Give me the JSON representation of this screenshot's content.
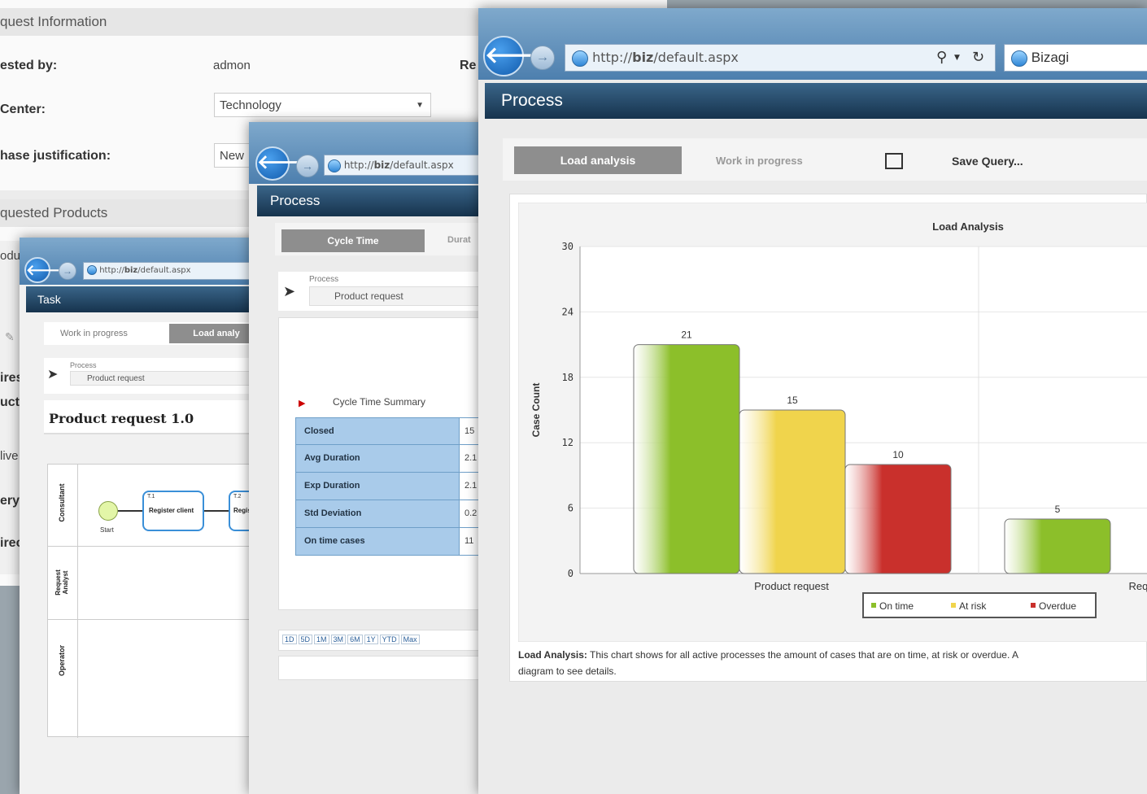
{
  "form": {
    "request_info_header": "quest Information",
    "requested_by_label": "ested by:",
    "requested_by_value": "admon",
    "right_label": "Re",
    "center_label": "Center:",
    "center_value": "Technology",
    "justification_label": "hase justification:",
    "justification_value": "New",
    "products_header": "quested Products",
    "side_labels": [
      "odu",
      "ires",
      "ucts",
      "live",
      "ery",
      "irec"
    ]
  },
  "win_small": {
    "url_prefix": "http://",
    "url_host": "biz",
    "url_path": "/default.aspx",
    "title": "Task",
    "tabs": [
      "Work in progress",
      "Load analy"
    ],
    "process_label": "Process",
    "process_value": "Product request",
    "heading": "Product request 1.0",
    "lanes": [
      "Consultant",
      "Request Analyst",
      "Operator"
    ],
    "diagram": {
      "start_label": "Start",
      "task1": "Register client",
      "task1_id": "T.1",
      "task2": "Registe",
      "task2_id": "T.2"
    }
  },
  "win_mid": {
    "url_prefix": "http://",
    "url_host": "biz",
    "url_path": "/default.aspx",
    "title": "Process",
    "tabs": [
      "Cycle Time",
      "Durat"
    ],
    "process_label": "Process",
    "process_value": "Product request",
    "summary_title": "Cycle Time Summary",
    "summary_rows": [
      {
        "label": "Closed",
        "value": "15"
      },
      {
        "label": "Avg Duration",
        "value": "2.1"
      },
      {
        "label": "Exp Duration",
        "value": "2.1"
      },
      {
        "label": "Std Deviation",
        "value": "0.2"
      },
      {
        "label": "On time cases",
        "value": "11"
      }
    ],
    "ranges": [
      "1D",
      "5D",
      "1M",
      "3M",
      "6M",
      "1Y",
      "YTD",
      "Max"
    ]
  },
  "win_main": {
    "url_prefix": "http://",
    "url_host": "biz",
    "url_path": "/default.aspx",
    "tab_title": "Bizagi",
    "title": "Process",
    "tabs": [
      "Load analysis",
      "Work in progress"
    ],
    "save_query": "Save Query...",
    "caption_bold": "Load Analysis:",
    "caption_line1": " This chart shows for all active processes the amount of cases that are on time, at risk or overdue. A",
    "caption_line2": "diagram to see details."
  },
  "chart_data": {
    "type": "bar",
    "title": "Load Analysis",
    "ylabel": "Case Count",
    "ylim": [
      0,
      30
    ],
    "yticks": [
      0,
      6,
      12,
      18,
      24,
      30
    ],
    "categories": [
      "Product request",
      "Requ"
    ],
    "series": [
      {
        "name": "On time",
        "values": [
          21,
          5
        ]
      },
      {
        "name": "At risk",
        "values": [
          15,
          null
        ]
      },
      {
        "name": "Overdue",
        "values": [
          10,
          null
        ]
      }
    ],
    "legend_position": "bottom",
    "colors": {
      "On time": "#8cbf2a",
      "At risk": "#f0d44c",
      "Overdue": "#c9302c"
    }
  }
}
